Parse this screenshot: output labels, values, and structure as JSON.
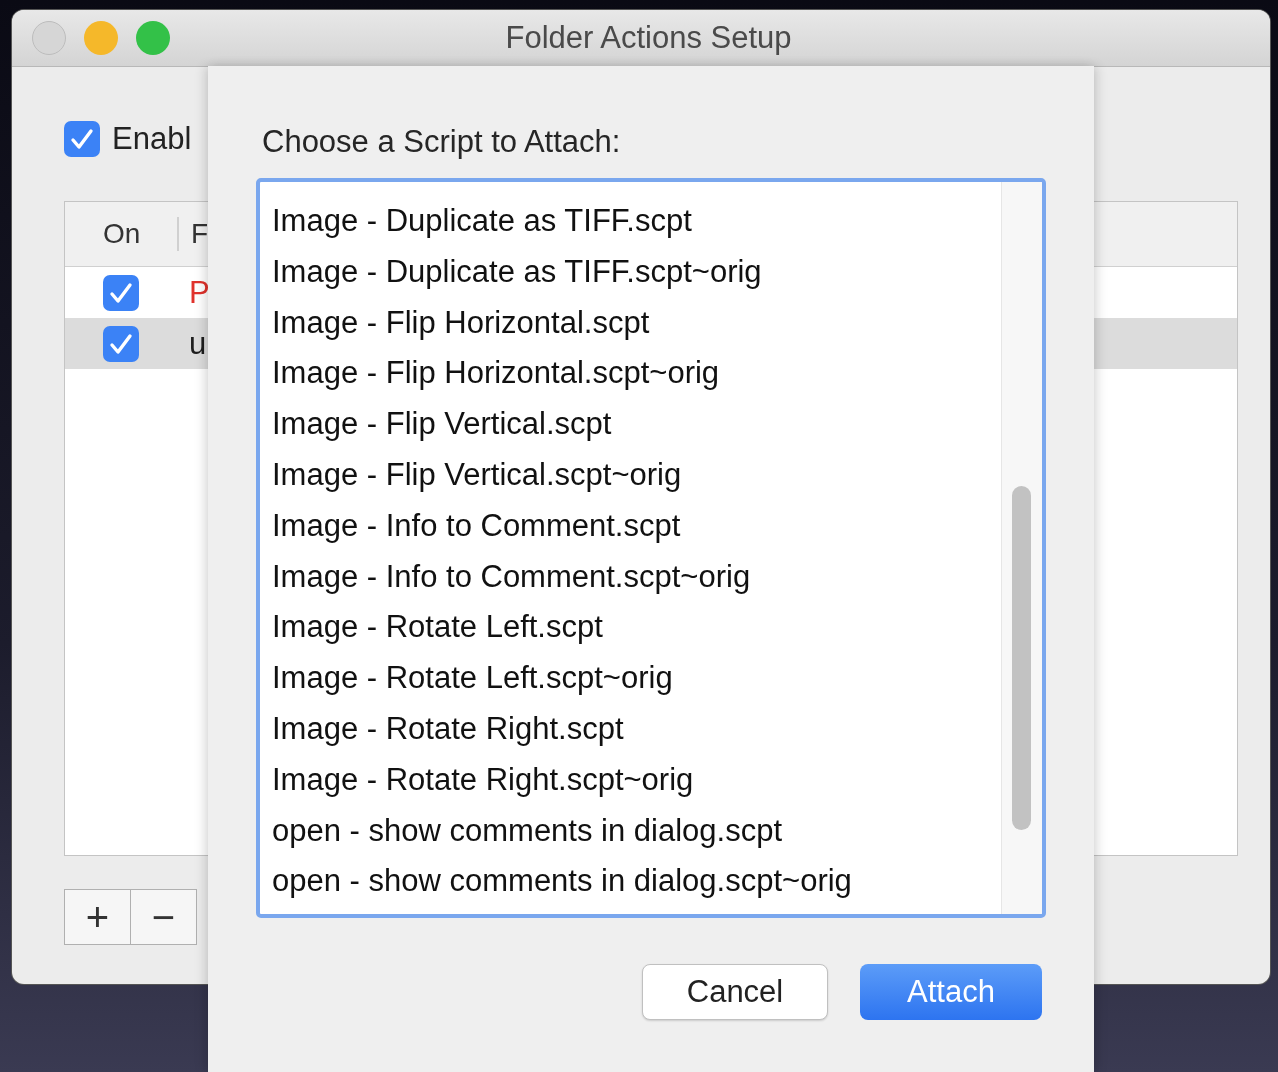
{
  "window": {
    "title": "Folder Actions Setup"
  },
  "enable": {
    "label": "Enabl",
    "checked": true
  },
  "table": {
    "columns": [
      "On",
      "F"
    ],
    "rows": [
      {
        "on": true,
        "name": "P",
        "color": "#e0322c",
        "selected": false
      },
      {
        "on": true,
        "name": "u",
        "color": "#1e1e1e",
        "selected": true
      }
    ]
  },
  "table_buttons": [
    "+",
    "−"
  ],
  "sheet": {
    "prompt": "Choose a Script to Attach:",
    "scripts": [
      {
        "name": "Image - Duplicate as TIFF.scpt",
        "selected": false
      },
      {
        "name": "Image - Duplicate as TIFF.scpt~orig",
        "selected": false
      },
      {
        "name": "Image - Flip Horizontal.scpt",
        "selected": false
      },
      {
        "name": "Image - Flip Horizontal.scpt~orig",
        "selected": false
      },
      {
        "name": "Image - Flip Vertical.scpt",
        "selected": false
      },
      {
        "name": "Image - Flip Vertical.scpt~orig",
        "selected": false
      },
      {
        "name": "Image - Info to Comment.scpt",
        "selected": false
      },
      {
        "name": "Image - Info to Comment.scpt~orig",
        "selected": false
      },
      {
        "name": "Image - Rotate Left.scpt",
        "selected": false
      },
      {
        "name": "Image - Rotate Left.scpt~orig",
        "selected": false
      },
      {
        "name": "Image - Rotate Right.scpt",
        "selected": false
      },
      {
        "name": "Image - Rotate Right.scpt~orig",
        "selected": false
      },
      {
        "name": "open - show comments in dialog.scpt",
        "selected": false
      },
      {
        "name": "open - show comments in dialog.scpt~orig",
        "selected": false
      }
    ],
    "buttons": [
      {
        "label": "Cancel",
        "kind": "secondary"
      },
      {
        "label": "Attach",
        "kind": "default"
      }
    ]
  }
}
